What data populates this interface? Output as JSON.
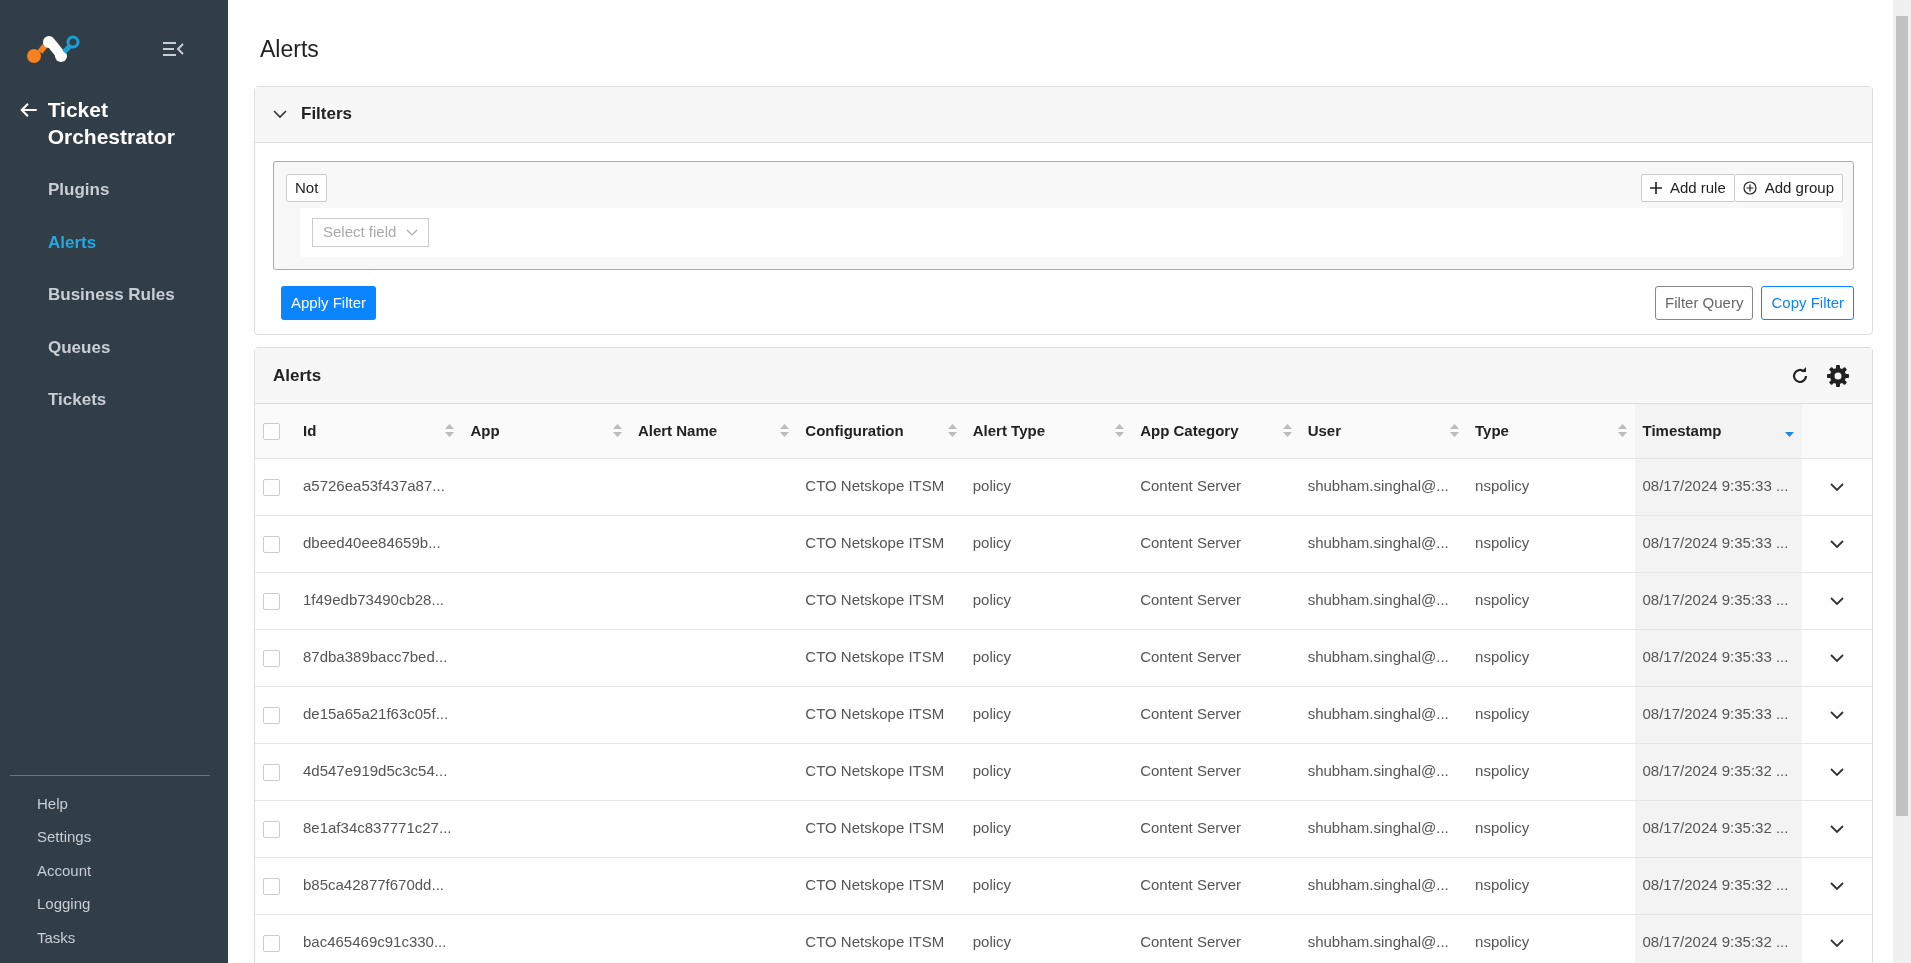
{
  "sidebar": {
    "back_title": "Ticket Orchestrator",
    "nav": [
      {
        "label": "Plugins",
        "selected": false
      },
      {
        "label": "Alerts",
        "selected": true
      },
      {
        "label": "Business Rules",
        "selected": false
      },
      {
        "label": "Queues",
        "selected": false
      },
      {
        "label": "Tickets",
        "selected": false
      }
    ],
    "footer_links": [
      "Help",
      "Settings",
      "Account",
      "Logging",
      "Tasks"
    ]
  },
  "page_title": "Alerts",
  "filters": {
    "title": "Filters",
    "expanded": true,
    "not_label": "Not",
    "add_rule": "Add rule",
    "add_group": "Add group",
    "field_placeholder": "Select field",
    "apply": "Apply Filter",
    "filter_query": "Filter Query",
    "copy_filter": "Copy Filter"
  },
  "alerts_table": {
    "title": "Alerts",
    "select_all_checked": false,
    "columns": [
      {
        "label": "Id",
        "sorted": false
      },
      {
        "label": "App",
        "sorted": false
      },
      {
        "label": "Alert Name",
        "sorted": false
      },
      {
        "label": "Configuration",
        "sorted": false
      },
      {
        "label": "Alert Type",
        "sorted": false
      },
      {
        "label": "App Category",
        "sorted": false
      },
      {
        "label": "User",
        "sorted": false
      },
      {
        "label": "Type",
        "sorted": false
      },
      {
        "label": "Timestamp",
        "sorted": true
      }
    ],
    "rows": [
      {
        "checked": false,
        "cells": [
          "a5726ea53f437a87...",
          "",
          "",
          "CTO Netskope ITSM",
          "policy",
          "Content Server",
          "shubham.singhal@...",
          "nspolicy",
          "08/17/2024 9:35:33 ..."
        ]
      },
      {
        "checked": false,
        "cells": [
          "dbeed40ee84659b...",
          "",
          "",
          "CTO Netskope ITSM",
          "policy",
          "Content Server",
          "shubham.singhal@...",
          "nspolicy",
          "08/17/2024 9:35:33 ..."
        ]
      },
      {
        "checked": false,
        "cells": [
          "1f49edb73490cb28...",
          "",
          "",
          "CTO Netskope ITSM",
          "policy",
          "Content Server",
          "shubham.singhal@...",
          "nspolicy",
          "08/17/2024 9:35:33 ..."
        ]
      },
      {
        "checked": false,
        "cells": [
          "87dba389bacc7bed...",
          "",
          "",
          "CTO Netskope ITSM",
          "policy",
          "Content Server",
          "shubham.singhal@...",
          "nspolicy",
          "08/17/2024 9:35:33 ..."
        ]
      },
      {
        "checked": false,
        "cells": [
          "de15a65a21f63c05f...",
          "",
          "",
          "CTO Netskope ITSM",
          "policy",
          "Content Server",
          "shubham.singhal@...",
          "nspolicy",
          "08/17/2024 9:35:33 ..."
        ]
      },
      {
        "checked": false,
        "cells": [
          "4d547e919d5c3c54...",
          "",
          "",
          "CTO Netskope ITSM",
          "policy",
          "Content Server",
          "shubham.singhal@...",
          "nspolicy",
          "08/17/2024 9:35:32 ..."
        ]
      },
      {
        "checked": false,
        "cells": [
          "8e1af34c837771c27...",
          "",
          "",
          "CTO Netskope ITSM",
          "policy",
          "Content Server",
          "shubham.singhal@...",
          "nspolicy",
          "08/17/2024 9:35:32 ..."
        ]
      },
      {
        "checked": false,
        "cells": [
          "b85ca42877f670dd...",
          "",
          "",
          "CTO Netskope ITSM",
          "policy",
          "Content Server",
          "shubham.singhal@...",
          "nspolicy",
          "08/17/2024 9:35:32 ..."
        ]
      },
      {
        "checked": false,
        "cells": [
          "bac465469c91c330...",
          "",
          "",
          "CTO Netskope ITSM",
          "policy",
          "Content Server",
          "shubham.singhal@...",
          "nspolicy",
          "08/17/2024 9:35:32 ..."
        ]
      }
    ]
  }
}
